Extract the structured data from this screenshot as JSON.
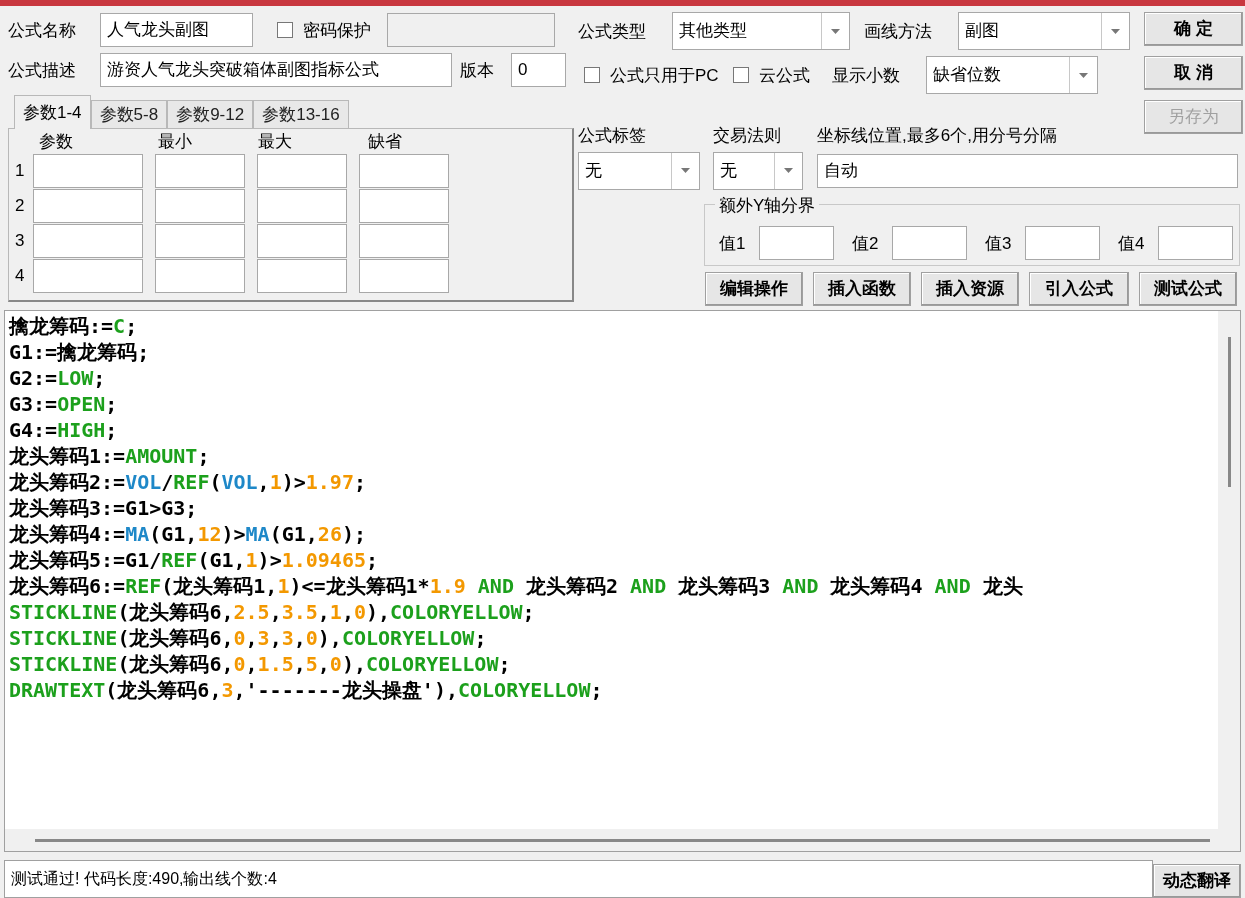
{
  "formula_name": {
    "label": "公式名称",
    "value": "人气龙头副图"
  },
  "password": {
    "label": "密码保护",
    "checked": false
  },
  "description": {
    "label": "公式描述",
    "value": "游资人气龙头突破箱体副图指标公式"
  },
  "version": {
    "label": "版本",
    "value": "0"
  },
  "param_tabs": [
    {
      "label": "参数1-4",
      "selected": true
    },
    {
      "label": "参数5-8",
      "selected": false
    },
    {
      "label": "参数9-12",
      "selected": false
    },
    {
      "label": "参数13-16",
      "selected": false
    }
  ],
  "param_table": {
    "columns": [
      "参数",
      "最小",
      "最大",
      "缺省"
    ],
    "rows": [
      "1",
      "2",
      "3",
      "4"
    ]
  },
  "formula_type": {
    "label": "公式类型",
    "value": "其他类型"
  },
  "draw_method": {
    "label": "画线方法",
    "value": "副图"
  },
  "pc_only": {
    "label": "公式只用于PC",
    "checked": false
  },
  "cloud": {
    "label": "云公式",
    "checked": false
  },
  "decimals": {
    "label": "显示小数",
    "value": "缺省位数"
  },
  "buttons": [
    {
      "label": "确 定",
      "disabled": false
    },
    {
      "label": "取 消",
      "disabled": false
    },
    {
      "label": "另存为",
      "disabled": true
    }
  ],
  "formula_tag": {
    "label": "公式标签",
    "value": "无"
  },
  "trade_rule": {
    "label": "交易法则",
    "value": "无"
  },
  "axis_lines": {
    "label": "坐标线位置,最多6个,用分号分隔",
    "value": "自动"
  },
  "y_axis_group": {
    "title": "额外Y轴分界",
    "fields": [
      {
        "label": "值1"
      },
      {
        "label": "值2"
      },
      {
        "label": "值3"
      },
      {
        "label": "值4"
      }
    ]
  },
  "tool_buttons": [
    "编辑操作",
    "插入函数",
    "插入资源",
    "引入公式",
    "测试公式"
  ],
  "code_lines": [
    [
      {
        "kind": "plain",
        "text": "擒龙筹码:="
      },
      {
        "kind": "keyword",
        "text": "C"
      },
      {
        "kind": "plain",
        "text": ";"
      }
    ],
    [
      {
        "kind": "plain",
        "text": "G1:=擒龙筹码;"
      }
    ],
    [
      {
        "kind": "plain",
        "text": "G2:="
      },
      {
        "kind": "keyword",
        "text": "LOW"
      },
      {
        "kind": "plain",
        "text": ";"
      }
    ],
    [
      {
        "kind": "plain",
        "text": "G3:="
      },
      {
        "kind": "keyword",
        "text": "OPEN"
      },
      {
        "kind": "plain",
        "text": ";"
      }
    ],
    [
      {
        "kind": "plain",
        "text": "G4:="
      },
      {
        "kind": "keyword",
        "text": "HIGH"
      },
      {
        "kind": "plain",
        "text": ";"
      }
    ],
    [
      {
        "kind": "plain",
        "text": "龙头筹码1:="
      },
      {
        "kind": "keyword",
        "text": "AMOUNT"
      },
      {
        "kind": "plain",
        "text": ";"
      }
    ],
    [
      {
        "kind": "plain",
        "text": "龙头筹码2:="
      },
      {
        "kind": "function",
        "text": "VOL"
      },
      {
        "kind": "plain",
        "text": "/"
      },
      {
        "kind": "keyword",
        "text": "REF"
      },
      {
        "kind": "plain",
        "text": "("
      },
      {
        "kind": "function",
        "text": "VOL"
      },
      {
        "kind": "plain",
        "text": ","
      },
      {
        "kind": "number",
        "text": "1"
      },
      {
        "kind": "plain",
        "text": ")>"
      },
      {
        "kind": "number",
        "text": "1.97"
      },
      {
        "kind": "plain",
        "text": ";"
      }
    ],
    [
      {
        "kind": "plain",
        "text": "龙头筹码3:=G1>G3;"
      }
    ],
    [
      {
        "kind": "plain",
        "text": "龙头筹码4:="
      },
      {
        "kind": "function",
        "text": "MA"
      },
      {
        "kind": "plain",
        "text": "(G1,"
      },
      {
        "kind": "number",
        "text": "12"
      },
      {
        "kind": "plain",
        "text": ")>"
      },
      {
        "kind": "function",
        "text": "MA"
      },
      {
        "kind": "plain",
        "text": "(G1,"
      },
      {
        "kind": "number",
        "text": "26"
      },
      {
        "kind": "plain",
        "text": ");"
      }
    ],
    [
      {
        "kind": "plain",
        "text": "龙头筹码5:=G1/"
      },
      {
        "kind": "keyword",
        "text": "REF"
      },
      {
        "kind": "plain",
        "text": "(G1,"
      },
      {
        "kind": "number",
        "text": "1"
      },
      {
        "kind": "plain",
        "text": ")>"
      },
      {
        "kind": "number",
        "text": "1.09465"
      },
      {
        "kind": "plain",
        "text": ";"
      }
    ],
    [
      {
        "kind": "plain",
        "text": "龙头筹码6:="
      },
      {
        "kind": "keyword",
        "text": "REF"
      },
      {
        "kind": "plain",
        "text": "(龙头筹码1,"
      },
      {
        "kind": "number",
        "text": "1"
      },
      {
        "kind": "plain",
        "text": ")<=龙头筹码1*"
      },
      {
        "kind": "number",
        "text": "1.9"
      },
      {
        "kind": "keyword",
        "text": " AND"
      },
      {
        "kind": "plain",
        "text": " 龙头筹码2 "
      },
      {
        "kind": "keyword",
        "text": "AND"
      },
      {
        "kind": "plain",
        "text": " 龙头筹码3 "
      },
      {
        "kind": "keyword",
        "text": "AND"
      },
      {
        "kind": "plain",
        "text": " 龙头筹码4 "
      },
      {
        "kind": "keyword",
        "text": "AND"
      },
      {
        "kind": "plain",
        "text": " 龙头"
      }
    ],
    [
      {
        "kind": "keyword",
        "text": "STICKLINE"
      },
      {
        "kind": "plain",
        "text": "(龙头筹码6,"
      },
      {
        "kind": "number",
        "text": "2.5"
      },
      {
        "kind": "plain",
        "text": ","
      },
      {
        "kind": "number",
        "text": "3.5"
      },
      {
        "kind": "plain",
        "text": ","
      },
      {
        "kind": "number",
        "text": "1"
      },
      {
        "kind": "plain",
        "text": ","
      },
      {
        "kind": "number",
        "text": "0"
      },
      {
        "kind": "plain",
        "text": "),"
      },
      {
        "kind": "keyword",
        "text": "COLORYELLOW"
      },
      {
        "kind": "plain",
        "text": ";"
      }
    ],
    [
      {
        "kind": "keyword",
        "text": "STICKLINE"
      },
      {
        "kind": "plain",
        "text": "(龙头筹码6,"
      },
      {
        "kind": "number",
        "text": "0"
      },
      {
        "kind": "plain",
        "text": ","
      },
      {
        "kind": "number",
        "text": "3"
      },
      {
        "kind": "plain",
        "text": ","
      },
      {
        "kind": "number",
        "text": "3"
      },
      {
        "kind": "plain",
        "text": ","
      },
      {
        "kind": "number",
        "text": "0"
      },
      {
        "kind": "plain",
        "text": "),"
      },
      {
        "kind": "keyword",
        "text": "COLORYELLOW"
      },
      {
        "kind": "plain",
        "text": ";"
      }
    ],
    [
      {
        "kind": "keyword",
        "text": "STICKLINE"
      },
      {
        "kind": "plain",
        "text": "(龙头筹码6,"
      },
      {
        "kind": "number",
        "text": "0"
      },
      {
        "kind": "plain",
        "text": ","
      },
      {
        "kind": "number",
        "text": "1.5"
      },
      {
        "kind": "plain",
        "text": ","
      },
      {
        "kind": "number",
        "text": "5"
      },
      {
        "kind": "plain",
        "text": ","
      },
      {
        "kind": "number",
        "text": "0"
      },
      {
        "kind": "plain",
        "text": "),"
      },
      {
        "kind": "keyword",
        "text": "COLORYELLOW"
      },
      {
        "kind": "plain",
        "text": ";"
      }
    ],
    [
      {
        "kind": "keyword",
        "text": "DRAWTEXT"
      },
      {
        "kind": "plain",
        "text": "(龙头筹码6,"
      },
      {
        "kind": "number",
        "text": "3"
      },
      {
        "kind": "plain",
        "text": ",'-------龙头操盘'),"
      },
      {
        "kind": "keyword",
        "text": "COLORYELLOW"
      },
      {
        "kind": "plain",
        "text": ";"
      }
    ]
  ],
  "status": {
    "message": "测试通过! 代码长度:490,输出线个数:4",
    "button": "动态翻译"
  }
}
